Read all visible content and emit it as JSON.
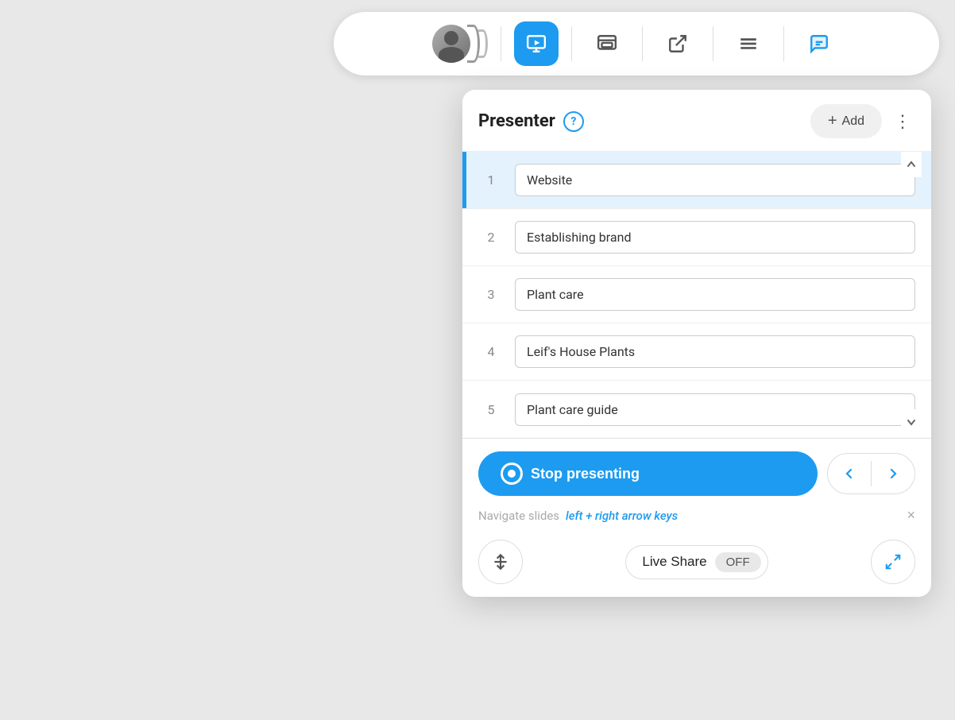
{
  "toolbar": {
    "present_label": "Present",
    "fullscreen_label": "Fullscreen",
    "export_label": "Export",
    "menu_label": "Menu",
    "chat_label": "Chat"
  },
  "panel": {
    "title": "Presenter",
    "help_label": "?",
    "add_label": "Add",
    "more_label": "⋮"
  },
  "slides": [
    {
      "number": "1",
      "name": "Website",
      "active": true
    },
    {
      "number": "2",
      "name": "Establishing brand",
      "active": false
    },
    {
      "number": "3",
      "name": "Plant care",
      "active": false
    },
    {
      "number": "4",
      "name": "Leif's House Plants",
      "active": false
    },
    {
      "number": "5",
      "name": "Plant care guide",
      "active": false
    }
  ],
  "controls": {
    "stop_label": "Stop presenting",
    "navigate_label": "Navigate slides",
    "keys_hint": "left + right arrow keys",
    "live_share_label": "Live Share",
    "live_share_status": "OFF"
  }
}
